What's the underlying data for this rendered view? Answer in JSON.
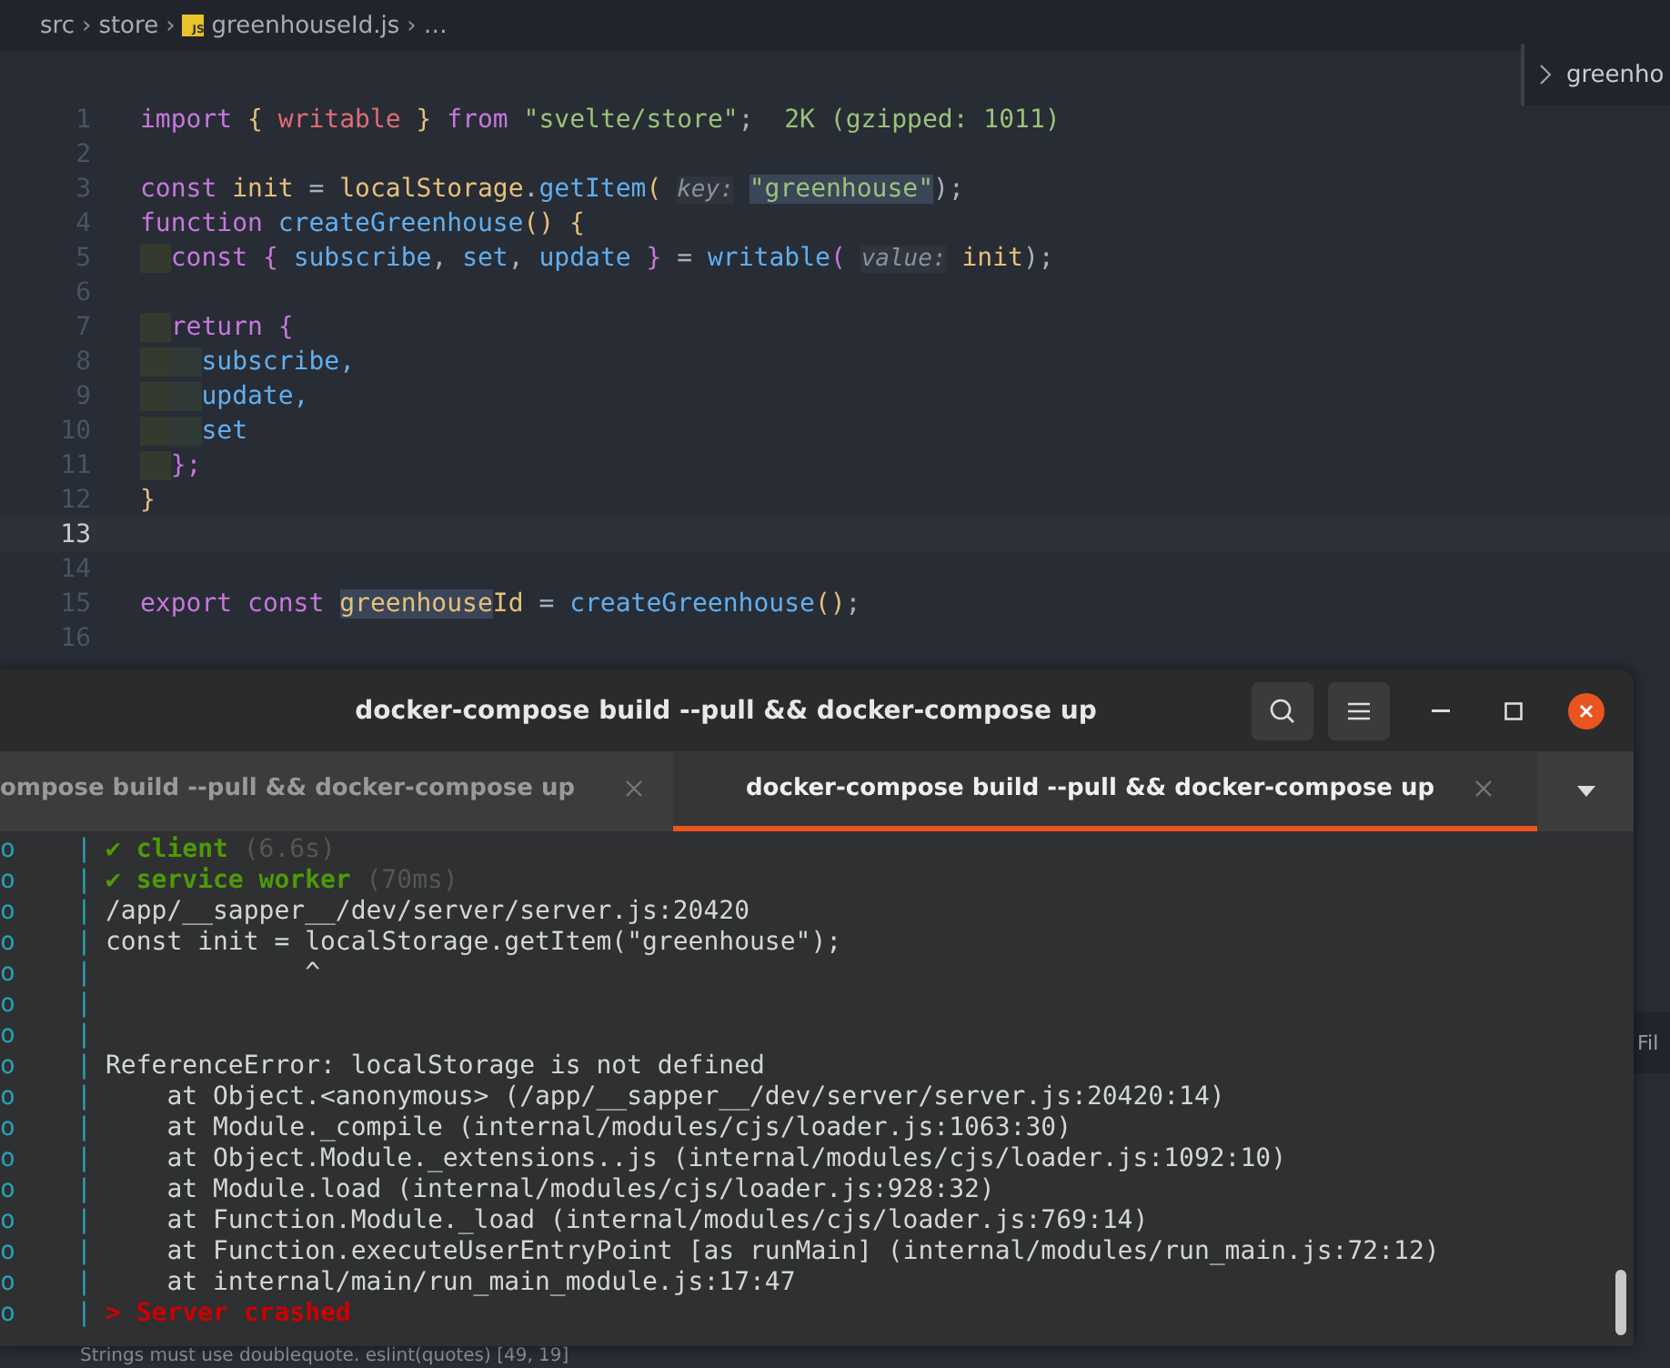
{
  "editor": {
    "breadcrumb": [
      {
        "label": "src",
        "kind": "folder",
        "separator": "›"
      },
      {
        "label": "store",
        "kind": "folder",
        "separator": "›"
      },
      {
        "label": "greenhouseId.js",
        "kind": "file",
        "badge": "JS",
        "separator": "›"
      },
      {
        "label": "…",
        "kind": "more"
      }
    ],
    "sticky_outline": {
      "label": "greenho"
    },
    "lines": [
      {
        "number": "1",
        "current": false,
        "tokens": [
          {
            "t": "import",
            "kind": "kw"
          },
          {
            "t": " {",
            "kind": "brace"
          },
          {
            "t": " writable",
            "kind": "var"
          },
          {
            "t": " }",
            "kind": "brace"
          },
          {
            "t": " from",
            "kind": "kw"
          },
          {
            "t": " \"svelte/store\"",
            "kind": "str"
          },
          {
            "t": ";",
            "kind": "plain"
          },
          {
            "t": "  2K (gzipped: 1011)",
            "kind": "size"
          }
        ]
      },
      {
        "number": "2",
        "current": false
      },
      {
        "number": "3",
        "current": false,
        "tokens": [
          {
            "t": "const",
            "kind": "kw"
          },
          {
            "t": " init",
            "kind": "ident"
          },
          {
            "t": " =",
            "kind": "plain"
          },
          {
            "t": " localStorage",
            "kind": "ident"
          },
          {
            "t": ".",
            "kind": "plain"
          },
          {
            "t": "getItem",
            "kind": "fn"
          },
          {
            "t": "(",
            "kind": "brace"
          },
          {
            "t": " key:",
            "kind": "hint"
          },
          {
            "t": " \"greenhouse\"",
            "kind": "strsel"
          },
          {
            "t": ");",
            "kind": "plain"
          }
        ]
      },
      {
        "number": "4",
        "current": false,
        "tokens": [
          {
            "t": "function",
            "kind": "kw"
          },
          {
            "t": " createGreenhouse",
            "kind": "fn"
          },
          {
            "t": "() {",
            "kind": "brace"
          }
        ]
      },
      {
        "number": "5",
        "current": false,
        "tokens": [
          {
            "t": "  const",
            "kind": "kw"
          },
          {
            "t": " {",
            "kind": "pbrace"
          },
          {
            "t": " subscribe",
            "kind": "fn"
          },
          {
            "t": ",",
            "kind": "plain"
          },
          {
            "t": " set",
            "kind": "fn"
          },
          {
            "t": ",",
            "kind": "plain"
          },
          {
            "t": " update",
            "kind": "fn"
          },
          {
            "t": " }",
            "kind": "pbrace"
          },
          {
            "t": " =",
            "kind": "plain"
          },
          {
            "t": " writable",
            "kind": "fn"
          },
          {
            "t": "(",
            "kind": "pbrace"
          },
          {
            "t": " value:",
            "kind": "hint"
          },
          {
            "t": " init",
            "kind": "ident"
          },
          {
            "t": ");",
            "kind": "plain"
          }
        ]
      },
      {
        "number": "6",
        "current": false
      },
      {
        "number": "7",
        "current": false,
        "tokens": [
          {
            "t": "  return",
            "kind": "kw"
          },
          {
            "t": " {",
            "kind": "pbrace"
          }
        ]
      },
      {
        "number": "8",
        "current": false,
        "tokens": [
          {
            "t": "    subscribe,",
            "kind": "fn"
          }
        ]
      },
      {
        "number": "9",
        "current": false,
        "tokens": [
          {
            "t": "    update,",
            "kind": "fn"
          }
        ]
      },
      {
        "number": "10",
        "current": false,
        "tokens": [
          {
            "t": "    set",
            "kind": "fn"
          }
        ]
      },
      {
        "number": "11",
        "current": false,
        "tokens": [
          {
            "t": "  };",
            "kind": "pbrace"
          }
        ]
      },
      {
        "number": "12",
        "current": false,
        "tokens": [
          {
            "t": "}",
            "kind": "brace"
          }
        ]
      },
      {
        "number": "13",
        "current": true
      },
      {
        "number": "14",
        "current": false
      },
      {
        "number": "15",
        "current": false,
        "tokens": [
          {
            "t": "export",
            "kind": "kw"
          },
          {
            "t": " const",
            "kind": "kw"
          },
          {
            "t": " greenhouse",
            "kind": "identsel"
          },
          {
            "t": "Id",
            "kind": "ident"
          },
          {
            "t": " =",
            "kind": "plain"
          },
          {
            "t": " createGreenhouse",
            "kind": "fn"
          },
          {
            "t": "()",
            "kind": "brace"
          },
          {
            "t": ";",
            "kind": "plain"
          }
        ]
      },
      {
        "number": "16",
        "current": false
      }
    ],
    "side_panel_tab": {
      "label": "Fil"
    },
    "problem_line": {
      "text": "Strings must use doublequote. eslint(quotes) [49, 19]"
    }
  },
  "terminal": {
    "title": "docker-compose build --pull && docker-compose up",
    "tabs": [
      {
        "label": "ompose build --pull && docker-compose up",
        "selected": false
      },
      {
        "label": "docker-compose build --pull && docker-compose up",
        "selected": true
      }
    ],
    "lines": [
      {
        "prefix": "o",
        "separator": "|",
        "tokens": [
          {
            "t": "✔ client",
            "kind": "ok"
          },
          {
            "t": " (6.6s)",
            "kind": "dim"
          }
        ]
      },
      {
        "prefix": "o",
        "separator": "|",
        "tokens": [
          {
            "t": "✔ service worker",
            "kind": "ok"
          },
          {
            "t": " (70ms)",
            "kind": "dim"
          }
        ]
      },
      {
        "prefix": "o",
        "separator": "|",
        "tokens": [
          {
            "t": "/app/__sapper__/dev/server/server.js:20420",
            "kind": "plain"
          }
        ]
      },
      {
        "prefix": "o",
        "separator": "|",
        "tokens": [
          {
            "t": "const init = localStorage.getItem(\"greenhouse\");",
            "kind": "plain"
          }
        ]
      },
      {
        "prefix": "o",
        "separator": "|",
        "tokens": [
          {
            "t": "             ^",
            "kind": "plain"
          }
        ]
      },
      {
        "prefix": "o",
        "separator": "|"
      },
      {
        "prefix": "o",
        "separator": "|"
      },
      {
        "prefix": "o",
        "separator": "|",
        "tokens": [
          {
            "t": "ReferenceError: localStorage is not defined",
            "kind": "plain"
          }
        ]
      },
      {
        "prefix": "o",
        "separator": "|",
        "tokens": [
          {
            "t": "    at Object.<anonymous> (/app/__sapper__/dev/server/server.js:20420:14)",
            "kind": "plain"
          }
        ]
      },
      {
        "prefix": "o",
        "separator": "|",
        "tokens": [
          {
            "t": "    at Module._compile (internal/modules/cjs/loader.js:1063:30)",
            "kind": "plain"
          }
        ]
      },
      {
        "prefix": "o",
        "separator": "|",
        "tokens": [
          {
            "t": "    at Object.Module._extensions..js (internal/modules/cjs/loader.js:1092:10)",
            "kind": "plain"
          }
        ]
      },
      {
        "prefix": "o",
        "separator": "|",
        "tokens": [
          {
            "t": "    at Module.load (internal/modules/cjs/loader.js:928:32)",
            "kind": "plain"
          }
        ]
      },
      {
        "prefix": "o",
        "separator": "|",
        "tokens": [
          {
            "t": "    at Function.Module._load (internal/modules/cjs/loader.js:769:14)",
            "kind": "plain"
          }
        ]
      },
      {
        "prefix": "o",
        "separator": "|",
        "tokens": [
          {
            "t": "    at Function.executeUserEntryPoint [as runMain] (internal/modules/run_main.js:72:12)",
            "kind": "plain"
          }
        ]
      },
      {
        "prefix": "o",
        "separator": "|",
        "tokens": [
          {
            "t": "    at internal/main/run_main_module.js:17:47",
            "kind": "plain"
          }
        ]
      },
      {
        "prefix": "o",
        "separator": "|",
        "tokens": [
          {
            "t": "> Server crashed",
            "kind": "err"
          }
        ]
      }
    ]
  }
}
